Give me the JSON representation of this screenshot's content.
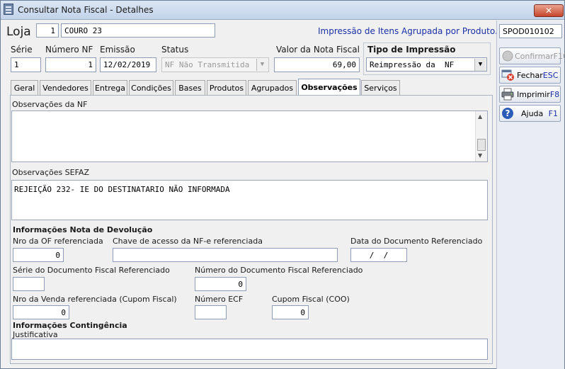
{
  "window": {
    "title": "Consultar Nota Fiscal - Detalhes",
    "close": "✕"
  },
  "header": {
    "loja_label": "Loja",
    "loja_code": "1",
    "loja_name": "COURO 23",
    "print_note": "Impressão de Itens Agrupada por Produto."
  },
  "fields": {
    "serie_label": "Série",
    "serie_value": "1",
    "numero_label": "Número NF",
    "numero_value": "1",
    "emissao_label": "Emissão",
    "emissao_value": "12/02/2019",
    "status_label": "Status",
    "status_value": "NF Não Transmitida",
    "valor_label": "Valor da Nota Fiscal",
    "valor_value": "69,00"
  },
  "print_type": {
    "label": "Tipo de Impressão",
    "selected": "Reimpressão da  NF"
  },
  "tabs": [
    "Geral",
    "Vendedores",
    "Entrega",
    "Condições",
    "Bases",
    "Produtos",
    "Agrupados",
    "Observações",
    "Serviços"
  ],
  "active_tab": "Observações",
  "observations": {
    "nf_label": "Observações da NF",
    "nf_text": "",
    "sefaz_label": "Observações SEFAZ",
    "sefaz_text": "REJEIÇÃO 232- IE DO DESTINATARIO NÃO INFORMADA"
  },
  "devolucao": {
    "section_title": "Informações Nota de Devolução",
    "nro_of_label": "Nro da OF referenciada",
    "nro_of_value": "0",
    "chave_label": "Chave de acesso da NF-e referenciada",
    "chave_value": "",
    "data_doc_label": "Data do Documento Referenciado",
    "data_doc_value": "/  /",
    "serie_doc_label": "Série do Documento Fiscal Referenciado",
    "serie_doc_value": "",
    "numero_doc_label": "Número do Documento Fiscal Referenciado",
    "numero_doc_value": "0",
    "nro_venda_label": "Nro da Venda referenciada (Cupom Fiscal)",
    "nro_venda_value": "0",
    "numero_ecf_label": "Número ECF",
    "numero_ecf_value": "",
    "cupom_label": "Cupom Fiscal (COO)",
    "cupom_value": "0"
  },
  "contingencia": {
    "section_title": "Informações Contingência",
    "justificativa_label": "Justificativa",
    "justificativa_value": ""
  },
  "sidebar": {
    "screen_code": "SPOD010102",
    "confirmar_label": "Confirmar",
    "confirmar_key": "F10",
    "fechar_label": "Fechar",
    "fechar_key": "ESC",
    "imprimir_label": "Imprimir",
    "imprimir_key": "F8",
    "ajuda_label": "Ajuda",
    "ajuda_key": "F1"
  },
  "colors": {
    "accent_blue": "#1a2fa8",
    "help_icon": "#2b5cb8",
    "close_red": "#c7452b"
  }
}
